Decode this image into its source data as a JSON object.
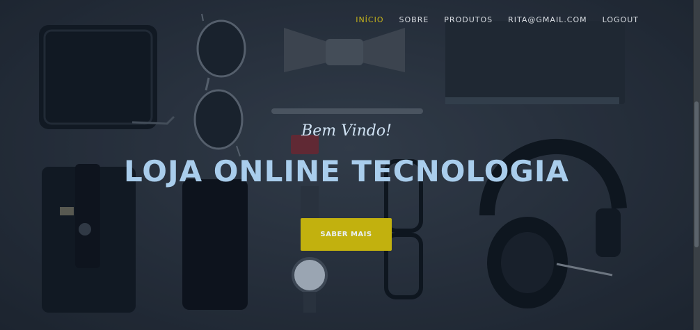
{
  "nav": {
    "items": [
      {
        "label": "INÍCIO",
        "active": true
      },
      {
        "label": "SOBRE",
        "active": false
      },
      {
        "label": "PRODUTOS",
        "active": false
      },
      {
        "label": "RITA@GMAIL.COM",
        "active": false
      },
      {
        "label": "LOGOUT",
        "active": false
      }
    ]
  },
  "hero": {
    "subtitle": "Bem Vindo!",
    "title": "LOJA ONLINE TECNOLOGIA",
    "button_label": "SABER MAIS"
  },
  "colors": {
    "accent": "#c2b10e",
    "title": "#a9cdec",
    "nav_text": "#d9dde2",
    "background": "#2b3036"
  }
}
